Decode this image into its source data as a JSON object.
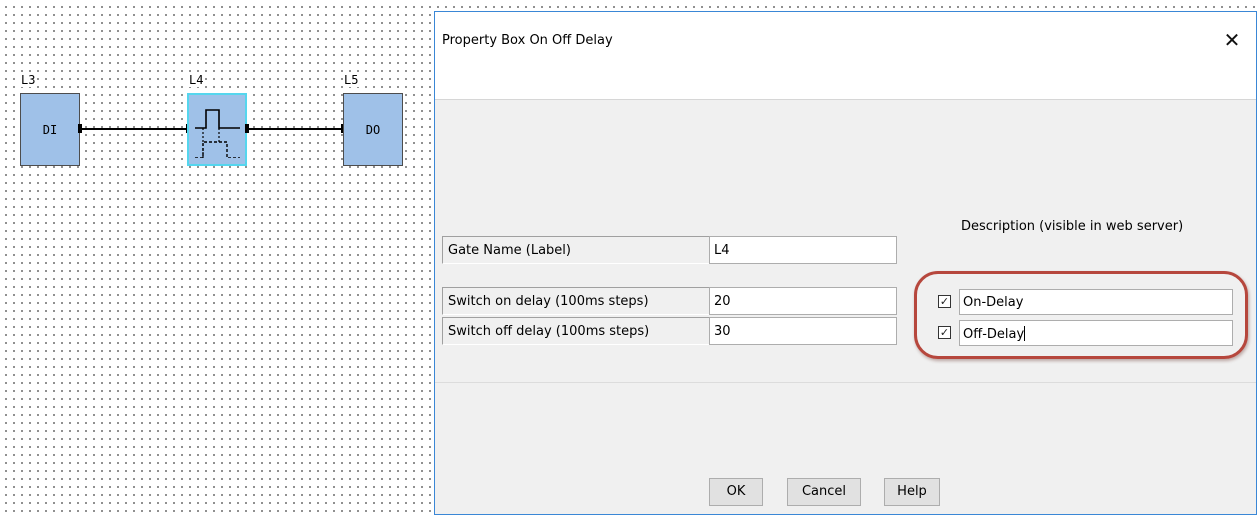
{
  "canvas": {
    "gates": [
      {
        "label": "L3",
        "text": "DI"
      },
      {
        "label": "L4",
        "text": ""
      },
      {
        "label": "L5",
        "text": "DO"
      }
    ]
  },
  "dialog": {
    "title": "Property Box On Off Delay",
    "close_glyph": "✕",
    "gate_name_label": "Gate Name (Label)",
    "gate_name_value": "L4",
    "on_delay_label": "Switch on delay (100ms steps)",
    "on_delay_value": "20",
    "off_delay_label": "Switch off delay (100ms steps)",
    "off_delay_value": "30",
    "description_header": "Description (visible in web server)",
    "on_desc": {
      "checked": true,
      "value": "On-Delay"
    },
    "off_desc": {
      "checked": true,
      "value": "Off-Delay"
    },
    "check_glyph": "✓",
    "buttons": {
      "ok": "OK",
      "cancel": "Cancel",
      "help": "Help"
    }
  },
  "colors": {
    "block_fill": "#9fc1e8",
    "selected_border": "#55d6ee",
    "highlight_ring": "#b6473d",
    "dialog_border": "#3a87d6"
  },
  "icons": {
    "on_off_delay": "on-off-delay-symbol-icon",
    "close": "close-icon",
    "checkbox": "checkmark-icon"
  }
}
